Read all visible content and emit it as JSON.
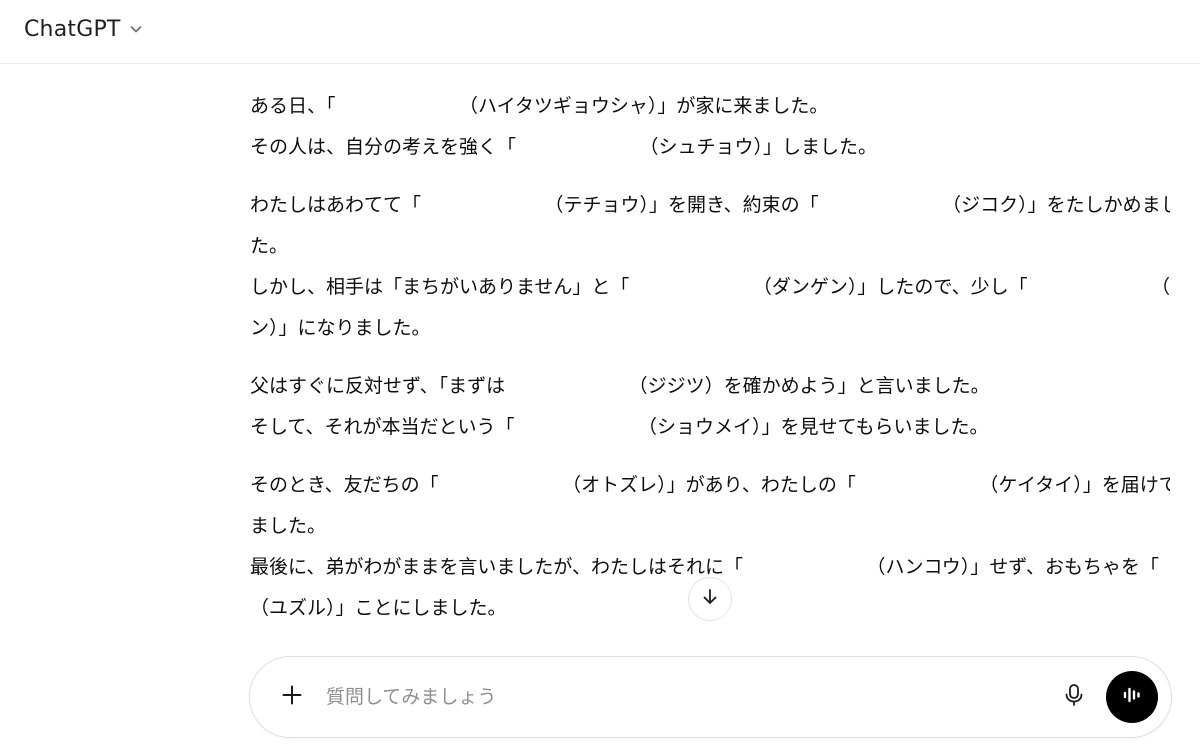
{
  "header": {
    "model_name": "ChatGPT",
    "chevron_icon": "chevron-down-icon"
  },
  "message": {
    "paragraphs": [
      [
        "ある日、「　　　　　　　（ハイタツギョウシャ）」が家に来ました。",
        "その人は、自分の考えを強く「　　　　　　　（シュチョウ）」しました。"
      ],
      [
        "わたしはあわてて「　　　　　　　（テチョウ）」を開き、約束の「　　　　　　　（ジコク）」をたしかめまし",
        "た。",
        "しかし、相手は「まちがいありません」と「　　　　　　　（ダンゲン）」したので、少し「　　　　　　　（フア",
        "ン）」になりました。"
      ],
      [
        "父はすぐに反対せず、「まずは　　　　　　　（ジジツ）を確かめよう」と言いました。",
        "そして、それが本当だという「　　　　　　　（ショウメイ）」を見せてもらいました。"
      ],
      [
        "そのとき、友だちの「　　　　　　　（オトズレ）」があり、わたしの「　　　　　　　（ケイタイ）」を届けてくれ",
        "ました。",
        "最後に、弟がわがままを言いましたが、わたしはそれに「　　　　　　　（ハンコウ）」せず、おもちゃを「",
        "（ユズル）」ことにしました。"
      ]
    ]
  },
  "scroll_button": {
    "icon": "arrow-down-icon"
  },
  "composer": {
    "placeholder": "質問してみましょう",
    "value": "",
    "plus_icon": "plus-icon",
    "mic_icon": "microphone-icon",
    "voice_icon": "voice-mode-icon"
  },
  "colors": {
    "text": "#0d0d0d",
    "placeholder": "#8f8f8f",
    "border": "#dedede",
    "voice_button": "#000000"
  }
}
